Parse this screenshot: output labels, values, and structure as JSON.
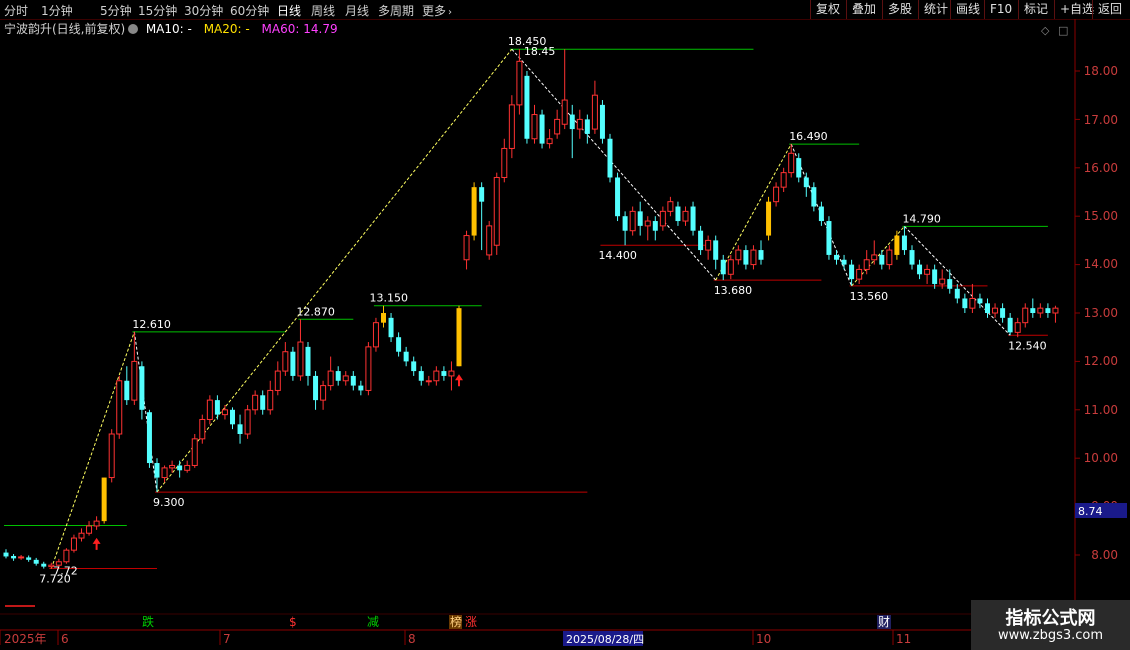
{
  "toolbar": {
    "periods": [
      "分时",
      "1分钟",
      "5分钟",
      "15分钟",
      "30分钟",
      "60分钟",
      "日线",
      "周线",
      "月线",
      "多周期",
      "更多"
    ],
    "active_period": "日线",
    "right_buttons": [
      "复权",
      "叠加",
      "多股",
      "统计",
      "画线",
      "F10",
      "标记",
      "+自选",
      "返回"
    ]
  },
  "header": {
    "stock_name": "宁波韵升(日线,前复权)",
    "ma10": "MA10: -",
    "ma20": "MA20: -",
    "ma60": "MA60: 14.79"
  },
  "price_axis": {
    "ticks": [
      "18.00",
      "17.00",
      "16.00",
      "15.00",
      "14.00",
      "13.00",
      "12.00",
      "11.00",
      "10.00",
      "9.00",
      "8.00"
    ],
    "current_label": "8.74"
  },
  "date_axis": {
    "labels": [
      "2025年",
      "6",
      "7",
      "8",
      "2025/08/28/四",
      "10",
      "11"
    ]
  },
  "markers": [
    "跌",
    "$",
    "减",
    "榜",
    "涨",
    "财"
  ],
  "chart_data": {
    "type": "candlestick",
    "title": "宁波韵升(日线,前复权)",
    "y_ticks": [
      8,
      9,
      10,
      11,
      12,
      13,
      14,
      15,
      16,
      17,
      18
    ],
    "ylim": [
      7.3,
      18.8
    ],
    "price_label": 8.74,
    "peak_trough_labels": [
      {
        "text": "7.720",
        "kind": "low"
      },
      {
        "text": "7.72",
        "kind": "low"
      },
      {
        "text": "12.610",
        "kind": "high"
      },
      {
        "text": "9.300",
        "kind": "low"
      },
      {
        "text": "12.870",
        "kind": "high"
      },
      {
        "text": "13.150",
        "kind": "high"
      },
      {
        "text": "18.450",
        "kind": "high"
      },
      {
        "text": "18.45",
        "kind": "high"
      },
      {
        "text": "14.400",
        "kind": "low"
      },
      {
        "text": "13.680",
        "kind": "low"
      },
      {
        "text": "16.490",
        "kind": "high"
      },
      {
        "text": "13.560",
        "kind": "low"
      },
      {
        "text": "14.790",
        "kind": "high"
      },
      {
        "text": "12.540",
        "kind": "low"
      }
    ],
    "candles": [
      {
        "o": 8.05,
        "c": 7.97,
        "h": 8.12,
        "l": 7.93
      },
      {
        "o": 7.98,
        "c": 7.93,
        "h": 8.02,
        "l": 7.88
      },
      {
        "o": 7.94,
        "c": 7.96,
        "h": 8.0,
        "l": 7.9
      },
      {
        "o": 7.95,
        "c": 7.9,
        "h": 7.99,
        "l": 7.86
      },
      {
        "o": 7.9,
        "c": 7.82,
        "h": 7.94,
        "l": 7.78
      },
      {
        "o": 7.82,
        "c": 7.76,
        "h": 7.86,
        "l": 7.72
      },
      {
        "o": 7.76,
        "c": 7.79,
        "h": 7.84,
        "l": 7.72
      },
      {
        "o": 7.79,
        "c": 7.86,
        "h": 7.92,
        "l": 7.74
      },
      {
        "o": 7.86,
        "c": 8.1,
        "h": 8.14,
        "l": 7.82
      },
      {
        "o": 8.1,
        "c": 8.35,
        "h": 8.42,
        "l": 8.05
      },
      {
        "o": 8.35,
        "c": 8.45,
        "h": 8.55,
        "l": 8.28
      },
      {
        "o": 8.45,
        "c": 8.6,
        "h": 8.7,
        "l": 8.4
      },
      {
        "o": 8.6,
        "c": 8.7,
        "h": 8.8,
        "l": 8.52
      },
      {
        "o": 8.7,
        "c": 9.6,
        "h": 9.6,
        "l": 8.65
      },
      {
        "o": 9.6,
        "c": 10.5,
        "h": 10.6,
        "l": 9.5
      },
      {
        "o": 10.5,
        "c": 11.6,
        "h": 11.7,
        "l": 10.4
      },
      {
        "o": 11.6,
        "c": 11.2,
        "h": 11.9,
        "l": 11.1
      },
      {
        "o": 11.2,
        "c": 12.0,
        "h": 12.61,
        "l": 11.1
      },
      {
        "o": 11.9,
        "c": 11.0,
        "h": 12.0,
        "l": 10.8
      },
      {
        "o": 10.95,
        "c": 9.9,
        "h": 11.0,
        "l": 9.8
      },
      {
        "o": 9.9,
        "c": 9.6,
        "h": 10.0,
        "l": 9.3
      },
      {
        "o": 9.6,
        "c": 9.8,
        "h": 9.85,
        "l": 9.5
      },
      {
        "o": 9.8,
        "c": 9.85,
        "h": 9.95,
        "l": 9.7
      },
      {
        "o": 9.85,
        "c": 9.75,
        "h": 9.95,
        "l": 9.6
      },
      {
        "o": 9.75,
        "c": 9.85,
        "h": 9.95,
        "l": 9.7
      },
      {
        "o": 9.85,
        "c": 10.4,
        "h": 10.5,
        "l": 9.8
      },
      {
        "o": 10.4,
        "c": 10.8,
        "h": 10.9,
        "l": 10.3
      },
      {
        "o": 10.8,
        "c": 11.2,
        "h": 11.3,
        "l": 10.7
      },
      {
        "o": 11.2,
        "c": 10.9,
        "h": 11.3,
        "l": 10.8
      },
      {
        "o": 10.9,
        "c": 11.0,
        "h": 11.1,
        "l": 10.8
      },
      {
        "o": 11.0,
        "c": 10.7,
        "h": 11.05,
        "l": 10.6
      },
      {
        "o": 10.7,
        "c": 10.5,
        "h": 10.9,
        "l": 10.3
      },
      {
        "o": 10.5,
        "c": 11.0,
        "h": 11.1,
        "l": 10.4
      },
      {
        "o": 11.0,
        "c": 11.3,
        "h": 11.4,
        "l": 10.9
      },
      {
        "o": 11.3,
        "c": 11.0,
        "h": 11.4,
        "l": 10.9
      },
      {
        "o": 11.0,
        "c": 11.4,
        "h": 11.6,
        "l": 10.9
      },
      {
        "o": 11.4,
        "c": 11.8,
        "h": 12.0,
        "l": 11.3
      },
      {
        "o": 11.8,
        "c": 12.2,
        "h": 12.4,
        "l": 11.7
      },
      {
        "o": 12.2,
        "c": 11.7,
        "h": 12.3,
        "l": 11.6
      },
      {
        "o": 11.7,
        "c": 12.4,
        "h": 12.87,
        "l": 11.6
      },
      {
        "o": 12.3,
        "c": 11.7,
        "h": 12.4,
        "l": 11.5
      },
      {
        "o": 11.7,
        "c": 11.2,
        "h": 11.8,
        "l": 11.0
      },
      {
        "o": 11.2,
        "c": 11.5,
        "h": 11.6,
        "l": 11.0
      },
      {
        "o": 11.5,
        "c": 11.8,
        "h": 12.1,
        "l": 11.4
      },
      {
        "o": 11.8,
        "c": 11.6,
        "h": 11.9,
        "l": 11.5
      },
      {
        "o": 11.6,
        "c": 11.7,
        "h": 11.8,
        "l": 11.5
      },
      {
        "o": 11.7,
        "c": 11.5,
        "h": 11.8,
        "l": 11.4
      },
      {
        "o": 11.5,
        "c": 11.4,
        "h": 11.6,
        "l": 11.3
      },
      {
        "o": 11.4,
        "c": 12.3,
        "h": 12.4,
        "l": 11.3
      },
      {
        "o": 12.3,
        "c": 12.8,
        "h": 12.9,
        "l": 12.2
      },
      {
        "o": 12.8,
        "c": 13.0,
        "h": 13.15,
        "l": 12.7
      },
      {
        "o": 12.9,
        "c": 12.5,
        "h": 13.0,
        "l": 12.4
      },
      {
        "o": 12.5,
        "c": 12.2,
        "h": 12.6,
        "l": 12.1
      },
      {
        "o": 12.2,
        "c": 12.0,
        "h": 12.3,
        "l": 11.9
      },
      {
        "o": 12.0,
        "c": 11.8,
        "h": 12.1,
        "l": 11.7
      },
      {
        "o": 11.8,
        "c": 11.6,
        "h": 11.9,
        "l": 11.5
      },
      {
        "o": 11.6,
        "c": 11.6,
        "h": 11.7,
        "l": 11.5
      },
      {
        "o": 11.6,
        "c": 11.8,
        "h": 11.9,
        "l": 11.5
      },
      {
        "o": 11.8,
        "c": 11.7,
        "h": 11.9,
        "l": 11.6
      },
      {
        "o": 11.7,
        "c": 11.8,
        "h": 12.0,
        "l": 11.4
      },
      {
        "o": 11.9,
        "c": 13.1,
        "h": 13.15,
        "l": 11.9
      },
      {
        "o": 14.1,
        "c": 14.6,
        "h": 14.7,
        "l": 13.9
      },
      {
        "o": 14.6,
        "c": 15.6,
        "h": 15.7,
        "l": 14.5
      },
      {
        "o": 15.6,
        "c": 15.3,
        "h": 15.7,
        "l": 14.3
      },
      {
        "o": 14.2,
        "c": 14.8,
        "h": 14.9,
        "l": 14.1
      },
      {
        "o": 14.4,
        "c": 15.8,
        "h": 15.9,
        "l": 14.2
      },
      {
        "o": 15.8,
        "c": 16.4,
        "h": 16.6,
        "l": 15.7
      },
      {
        "o": 16.4,
        "c": 17.3,
        "h": 17.5,
        "l": 16.2
      },
      {
        "o": 17.3,
        "c": 18.2,
        "h": 18.45,
        "l": 17.1
      },
      {
        "o": 17.9,
        "c": 16.6,
        "h": 18.0,
        "l": 16.5
      },
      {
        "o": 16.6,
        "c": 17.1,
        "h": 17.3,
        "l": 16.5
      },
      {
        "o": 17.1,
        "c": 16.5,
        "h": 17.2,
        "l": 16.4
      },
      {
        "o": 16.5,
        "c": 16.6,
        "h": 16.8,
        "l": 16.4
      },
      {
        "o": 16.7,
        "c": 17.0,
        "h": 17.2,
        "l": 16.6
      },
      {
        "o": 16.9,
        "c": 17.4,
        "h": 18.45,
        "l": 16.8
      },
      {
        "o": 17.1,
        "c": 16.8,
        "h": 17.3,
        "l": 16.2
      },
      {
        "o": 16.8,
        "c": 17.0,
        "h": 17.2,
        "l": 16.6
      },
      {
        "o": 17.0,
        "c": 16.7,
        "h": 17.1,
        "l": 16.5
      },
      {
        "o": 16.8,
        "c": 17.5,
        "h": 17.8,
        "l": 16.7
      },
      {
        "o": 17.3,
        "c": 16.6,
        "h": 17.4,
        "l": 16.5
      },
      {
        "o": 16.6,
        "c": 15.8,
        "h": 16.7,
        "l": 15.7
      },
      {
        "o": 15.8,
        "c": 15.0,
        "h": 15.9,
        "l": 14.9
      },
      {
        "o": 15.0,
        "c": 14.7,
        "h": 15.1,
        "l": 14.4
      },
      {
        "o": 14.7,
        "c": 15.1,
        "h": 15.2,
        "l": 14.6
      },
      {
        "o": 15.1,
        "c": 14.8,
        "h": 15.3,
        "l": 14.6
      },
      {
        "o": 14.8,
        "c": 14.9,
        "h": 15.0,
        "l": 14.5
      },
      {
        "o": 14.9,
        "c": 14.7,
        "h": 15.0,
        "l": 14.5
      },
      {
        "o": 14.8,
        "c": 15.1,
        "h": 15.2,
        "l": 14.7
      },
      {
        "o": 15.1,
        "c": 15.3,
        "h": 15.4,
        "l": 15.0
      },
      {
        "o": 15.2,
        "c": 14.9,
        "h": 15.3,
        "l": 14.8
      },
      {
        "o": 14.9,
        "c": 15.1,
        "h": 15.2,
        "l": 14.8
      },
      {
        "o": 15.2,
        "c": 14.7,
        "h": 15.3,
        "l": 14.6
      },
      {
        "o": 14.7,
        "c": 14.3,
        "h": 14.8,
        "l": 14.2
      },
      {
        "o": 14.3,
        "c": 14.5,
        "h": 14.6,
        "l": 14.1
      },
      {
        "o": 14.5,
        "c": 14.1,
        "h": 14.6,
        "l": 13.9
      },
      {
        "o": 14.1,
        "c": 13.8,
        "h": 14.2,
        "l": 13.68
      },
      {
        "o": 13.8,
        "c": 14.1,
        "h": 14.2,
        "l": 13.7
      },
      {
        "o": 14.1,
        "c": 14.3,
        "h": 14.4,
        "l": 14.0
      },
      {
        "o": 14.3,
        "c": 14.0,
        "h": 14.4,
        "l": 13.9
      },
      {
        "o": 14.0,
        "c": 14.3,
        "h": 14.4,
        "l": 13.9
      },
      {
        "o": 14.3,
        "c": 14.1,
        "h": 14.5,
        "l": 14.0
      },
      {
        "o": 14.6,
        "c": 15.3,
        "h": 15.4,
        "l": 14.5
      },
      {
        "o": 15.3,
        "c": 15.6,
        "h": 15.7,
        "l": 15.2
      },
      {
        "o": 15.6,
        "c": 15.9,
        "h": 16.0,
        "l": 15.5
      },
      {
        "o": 15.9,
        "c": 16.3,
        "h": 16.49,
        "l": 15.8
      },
      {
        "o": 16.2,
        "c": 15.8,
        "h": 16.3,
        "l": 15.7
      },
      {
        "o": 15.8,
        "c": 15.6,
        "h": 15.9,
        "l": 15.4
      },
      {
        "o": 15.6,
        "c": 15.2,
        "h": 15.7,
        "l": 15.1
      },
      {
        "o": 15.2,
        "c": 14.9,
        "h": 15.3,
        "l": 14.8
      },
      {
        "o": 14.9,
        "c": 14.2,
        "h": 15.0,
        "l": 14.1
      },
      {
        "o": 14.2,
        "c": 14.1,
        "h": 14.3,
        "l": 14.0
      },
      {
        "o": 14.1,
        "c": 14.0,
        "h": 14.2,
        "l": 13.9
      },
      {
        "o": 14.0,
        "c": 13.7,
        "h": 14.1,
        "l": 13.56
      },
      {
        "o": 13.7,
        "c": 13.9,
        "h": 14.0,
        "l": 13.6
      },
      {
        "o": 13.9,
        "c": 14.1,
        "h": 14.3,
        "l": 13.8
      },
      {
        "o": 14.1,
        "c": 14.2,
        "h": 14.5,
        "l": 14.0
      },
      {
        "o": 14.2,
        "c": 14.0,
        "h": 14.3,
        "l": 13.9
      },
      {
        "o": 14.0,
        "c": 14.3,
        "h": 14.4,
        "l": 13.9
      },
      {
        "o": 14.2,
        "c": 14.6,
        "h": 14.7,
        "l": 14.1
      },
      {
        "o": 14.6,
        "c": 14.3,
        "h": 14.79,
        "l": 14.2
      },
      {
        "o": 14.3,
        "c": 14.0,
        "h": 14.4,
        "l": 13.9
      },
      {
        "o": 14.0,
        "c": 13.8,
        "h": 14.1,
        "l": 13.7
      },
      {
        "o": 13.8,
        "c": 13.9,
        "h": 14.0,
        "l": 13.6
      },
      {
        "o": 13.9,
        "c": 13.6,
        "h": 14.0,
        "l": 13.5
      },
      {
        "o": 13.6,
        "c": 13.7,
        "h": 13.9,
        "l": 13.5
      },
      {
        "o": 13.7,
        "c": 13.5,
        "h": 13.9,
        "l": 13.4
      },
      {
        "o": 13.5,
        "c": 13.3,
        "h": 13.6,
        "l": 13.2
      },
      {
        "o": 13.3,
        "c": 13.1,
        "h": 13.4,
        "l": 13.0
      },
      {
        "o": 13.1,
        "c": 13.3,
        "h": 13.6,
        "l": 13.0
      },
      {
        "o": 13.3,
        "c": 13.2,
        "h": 13.4,
        "l": 13.1
      },
      {
        "o": 13.2,
        "c": 13.0,
        "h": 13.3,
        "l": 12.9
      },
      {
        "o": 13.0,
        "c": 13.1,
        "h": 13.2,
        "l": 12.9
      },
      {
        "o": 13.1,
        "c": 12.9,
        "h": 13.2,
        "l": 12.8
      },
      {
        "o": 12.9,
        "c": 12.6,
        "h": 13.0,
        "l": 12.54
      },
      {
        "o": 12.6,
        "c": 12.8,
        "h": 12.9,
        "l": 12.5
      },
      {
        "o": 12.8,
        "c": 13.1,
        "h": 13.2,
        "l": 12.7
      },
      {
        "o": 13.1,
        "c": 13.0,
        "h": 13.3,
        "l": 12.9
      },
      {
        "o": 13.0,
        "c": 13.1,
        "h": 13.2,
        "l": 12.9
      },
      {
        "o": 13.1,
        "c": 13.0,
        "h": 13.2,
        "l": 12.9
      },
      {
        "o": 13.0,
        "c": 13.1,
        "h": 13.15,
        "l": 12.8
      }
    ],
    "highlight_bars": [
      13,
      50,
      60,
      62,
      101,
      118
    ],
    "buy_arrows": [
      12,
      60
    ],
    "zigzag": [
      [
        6,
        7.72
      ],
      [
        17,
        12.61
      ],
      [
        20,
        9.3
      ],
      [
        67,
        18.45
      ],
      [
        94,
        13.68
      ],
      [
        104,
        16.49
      ],
      [
        112,
        13.56
      ],
      [
        119,
        14.79
      ],
      [
        133,
        12.54
      ]
    ]
  },
  "colors": {
    "up": "#ff3232",
    "down": "#54ffff",
    "highlight": "#ffc000",
    "ma60": "#ff40ff",
    "grid": "#3a0000",
    "resistance": "#00c000",
    "support": "#c00000"
  },
  "watermark": {
    "title": "指标公式网",
    "url": "www.zbgs3.com"
  }
}
